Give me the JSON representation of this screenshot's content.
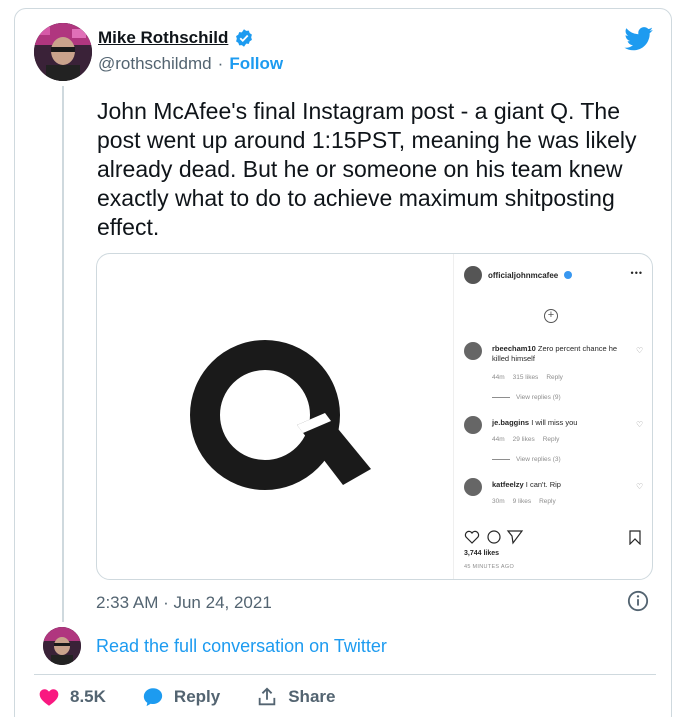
{
  "author": {
    "display_name": "Mike Rothschild",
    "handle": "@rothschildmd",
    "separator": "·",
    "follow_label": "Follow"
  },
  "tweet": {
    "text": "John McAfee's final Instagram post - a giant Q. The post went up around 1:15PST, meaning he was likely already dead. But he or someone on his team knew exactly what to do to achieve maximum shitposting effect.",
    "timestamp": "2:33 AM · Jun 24, 2021"
  },
  "instagram": {
    "username": "officialjohnmcafee",
    "post_glyph": "Q",
    "comments": [
      {
        "user": "rbeecham10",
        "text": "Zero percent chance he killed himself",
        "age": "44m",
        "likes": "315 likes",
        "reply": "Reply",
        "view_replies": "View replies (9)"
      },
      {
        "user": "je.baggins",
        "text": "I will miss you",
        "age": "44m",
        "likes": "29 likes",
        "reply": "Reply",
        "view_replies": "View replies (3)"
      },
      {
        "user": "katfeelzy",
        "text": "I can't. Rip",
        "age": "30m",
        "likes": "9 likes",
        "reply": "Reply"
      }
    ],
    "likes_total": "3,744 likes",
    "posted_ago": "45 MINUTES AGO"
  },
  "footer": {
    "read_conversation": "Read the full conversation on Twitter",
    "like_count": "8.5K",
    "reply_label": "Reply",
    "share_label": "Share"
  },
  "colors": {
    "accent": "#1d9bf0",
    "heart": "#f91880",
    "text": "#0f1419",
    "muted": "#536471",
    "border": "#cfd9de"
  },
  "icons": [
    "twitter-bird-icon",
    "verified-badge-icon",
    "info-icon",
    "heart-icon",
    "reply-bubble-icon",
    "share-icon",
    "ig-plus-icon",
    "ig-heart-icon",
    "ig-comment-icon",
    "ig-send-icon",
    "ig-bookmark-icon"
  ]
}
